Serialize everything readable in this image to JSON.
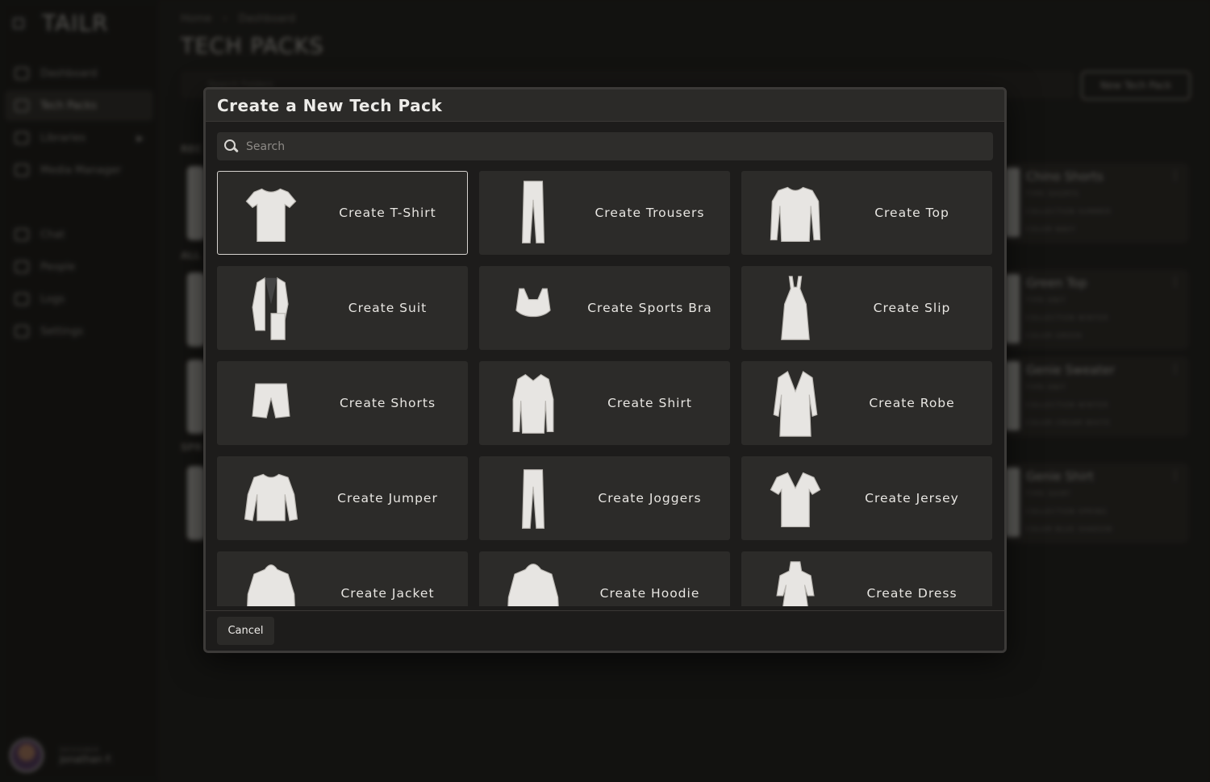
{
  "app": {
    "logo": "TAILR",
    "nav": [
      {
        "label": "Dashboard"
      },
      {
        "label": "Tech Packs",
        "active": true
      },
      {
        "label": "Libraries",
        "has_children": true
      },
      {
        "label": "Media Manager"
      },
      {
        "label": "Chat"
      },
      {
        "label": "People"
      },
      {
        "label": "Logs"
      },
      {
        "label": "Settings"
      }
    ],
    "user": {
      "role": "DESIGNER",
      "name": "Jonathan F."
    },
    "breadcrumb": [
      "Home",
      "Dashboard"
    ],
    "breadcrumb_sep": "›",
    "page_title": "TECH PACKS",
    "search_placeholder": "Search Folders",
    "new_button_label": "New Tech Pack",
    "sections": [
      "REC",
      "ALL",
      "SPR"
    ],
    "side_cards": [
      {
        "name": "Chino Shorts",
        "type": "TYPE  SHORTS",
        "collection": "COLLECTION  SUMMER",
        "color": "COLOR  NAVY"
      },
      {
        "name": "Green Top",
        "type": "TYPE  KNIT",
        "collection": "COLLECTION  WINTER",
        "color": "COLOR  GREEN"
      },
      {
        "name": "Genie Sweater",
        "type": "TYPE  KNIT",
        "collection": "COLLECTION  WINTER",
        "color": "COLOR  CREAM WHITE"
      },
      {
        "name": "Genie Shirt",
        "type": "TYPE  SHIRT",
        "collection": "COLLECTION  SPRING",
        "color": "COLOR  BLUE SHADOW"
      }
    ]
  },
  "modal": {
    "title": "Create a New Tech Pack",
    "search_placeholder": "Search",
    "cancel_label": "Cancel",
    "options": [
      {
        "label": "Create T-Shirt",
        "icon": "tshirt-icon",
        "selected": true
      },
      {
        "label": "Create Trousers",
        "icon": "trousers-icon"
      },
      {
        "label": "Create Top",
        "icon": "top-icon"
      },
      {
        "label": "Create Suit",
        "icon": "suit-icon"
      },
      {
        "label": "Create Sports Bra",
        "icon": "sports-bra-icon"
      },
      {
        "label": "Create Slip",
        "icon": "slip-dress-icon"
      },
      {
        "label": "Create Shorts",
        "icon": "shorts-icon"
      },
      {
        "label": "Create Shirt",
        "icon": "shirt-icon"
      },
      {
        "label": "Create Robe",
        "icon": "robe-icon"
      },
      {
        "label": "Create Jumper",
        "icon": "jumper-icon"
      },
      {
        "label": "Create Joggers",
        "icon": "joggers-icon"
      },
      {
        "label": "Create Jersey",
        "icon": "jersey-icon"
      },
      {
        "label": "Create Jacket",
        "icon": "jacket-icon"
      },
      {
        "label": "Create Hoodie",
        "icon": "hoodie-icon"
      },
      {
        "label": "Create Dress",
        "icon": "dress-icon"
      }
    ]
  },
  "colors": {
    "modal_bg": "#1d1c1b",
    "tile_bg": "#2c2b29",
    "selected_border": "#d6d3cf",
    "garment_fill": "#e7e5e2"
  }
}
